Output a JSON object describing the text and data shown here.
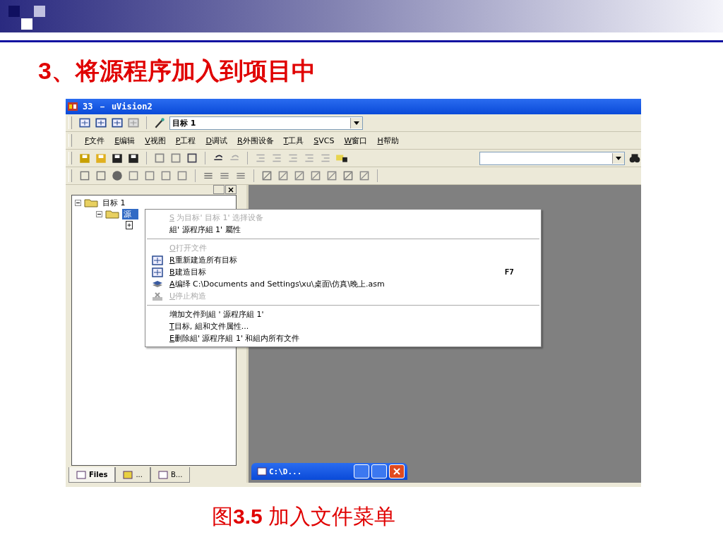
{
  "slide": {
    "title": "**3**、将源程序加入到项目中",
    "caption": "图**3.5**  加入文件菜单"
  },
  "app": {
    "title": "33  － uVision2",
    "target_select": "目标 1",
    "menu": [
      {
        "key": "F",
        "label": "文件"
      },
      {
        "key": "E",
        "label": "编辑"
      },
      {
        "key": "V",
        "label": "视图"
      },
      {
        "key": "P",
        "label": "工程"
      },
      {
        "key": "D",
        "label": "调试"
      },
      {
        "key": "R",
        "label": "外围设备"
      },
      {
        "key": "T",
        "label": "工具"
      },
      {
        "key": "S",
        "label": "VCS"
      },
      {
        "key": "W",
        "label": "窗口"
      },
      {
        "key": "H",
        "label": "帮助"
      }
    ],
    "tree": [
      {
        "label": "目标 1",
        "expanded": true,
        "selected": false,
        "children": [
          {
            "label": "源",
            "expanded": true,
            "selected": true,
            "children": [
              {
                "kind": "file"
              }
            ]
          }
        ]
      }
    ],
    "panel_tabs": [
      {
        "label": "Files",
        "selected": true
      },
      {
        "label": "...",
        "selected": false
      },
      {
        "label": "B...",
        "selected": false
      }
    ],
    "minimized_window": {
      "title": "C:\\D..."
    },
    "context_menu": {
      "items": [
        {
          "kind": "plain",
          "key": "S",
          "label": " 为目标' 目标 1' 选择设备",
          "disabled": true
        },
        {
          "kind": "plain",
          "label": "組' 源程序組 1' 屬性",
          "disabled": false
        },
        {
          "kind": "separator"
        },
        {
          "kind": "plain",
          "key": "O",
          "label": "打开文件",
          "disabled": true
        },
        {
          "kind": "build",
          "key": "R",
          "label": "重新建造所有目标",
          "disabled": false
        },
        {
          "kind": "build",
          "key": "B",
          "label": "建造目标",
          "shortcut": "F7",
          "disabled": false
        },
        {
          "kind": "compile",
          "key": "A",
          "label": "编绎 C:\\Documents and Settings\\xu\\桌面\\仿真\\晚上.asm",
          "disabled": false
        },
        {
          "kind": "stop",
          "key": "U",
          "label": "停止构造",
          "disabled": true
        },
        {
          "kind": "separator"
        },
        {
          "kind": "plain",
          "label": "增加文件到組 ' 源程序組 1'",
          "disabled": false
        },
        {
          "kind": "plain",
          "key": "T",
          "label": "目标, 組和文件属性...",
          "disabled": false
        },
        {
          "kind": "plain",
          "key": "E",
          "label": "删除組' 源程序組 1' 和組内所有文件",
          "disabled": false
        }
      ]
    }
  }
}
